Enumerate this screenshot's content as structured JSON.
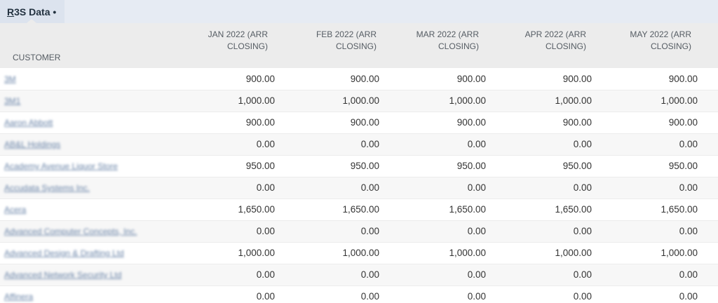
{
  "tab": {
    "title_first_letter": "R",
    "title_rest": "3S Data",
    "modified_dot": "•"
  },
  "table": {
    "headers": {
      "customer": "CUSTOMER",
      "months": [
        [
          "JAN 2022 (ARR",
          "CLOSING)"
        ],
        [
          "FEB 2022 (ARR",
          "CLOSING)"
        ],
        [
          "MAR 2022 (ARR",
          "CLOSING)"
        ],
        [
          "APR 2022 (ARR",
          "CLOSING)"
        ],
        [
          "MAY 2022 (ARR",
          "CLOSING)"
        ]
      ]
    },
    "rows": [
      {
        "customer": "3M",
        "values": [
          "900.00",
          "900.00",
          "900.00",
          "900.00",
          "900.00"
        ]
      },
      {
        "customer": "3M1",
        "values": [
          "1,000.00",
          "1,000.00",
          "1,000.00",
          "1,000.00",
          "1,000.00"
        ]
      },
      {
        "customer": "Aaron Abbott",
        "values": [
          "900.00",
          "900.00",
          "900.00",
          "900.00",
          "900.00"
        ]
      },
      {
        "customer": "AB&L Holdings",
        "values": [
          "0.00",
          "0.00",
          "0.00",
          "0.00",
          "0.00"
        ]
      },
      {
        "customer": "Academy Avenue Liquor Store",
        "values": [
          "950.00",
          "950.00",
          "950.00",
          "950.00",
          "950.00"
        ]
      },
      {
        "customer": "Accudata Systems Inc.",
        "values": [
          "0.00",
          "0.00",
          "0.00",
          "0.00",
          "0.00"
        ]
      },
      {
        "customer": "Acera",
        "values": [
          "1,650.00",
          "1,650.00",
          "1,650.00",
          "1,650.00",
          "1,650.00"
        ]
      },
      {
        "customer": "Advanced Computer Concepts, Inc.",
        "values": [
          "0.00",
          "0.00",
          "0.00",
          "0.00",
          "0.00"
        ]
      },
      {
        "customer": "Advanced Design & Drafting Ltd",
        "values": [
          "1,000.00",
          "1,000.00",
          "1,000.00",
          "1,000.00",
          "1,000.00"
        ]
      },
      {
        "customer": "Advanced Network Security Ltd",
        "values": [
          "0.00",
          "0.00",
          "0.00",
          "0.00",
          "0.00"
        ]
      },
      {
        "customer": "Affinera",
        "values": [
          "0.00",
          "0.00",
          "0.00",
          "0.00",
          "0.00"
        ]
      }
    ]
  }
}
